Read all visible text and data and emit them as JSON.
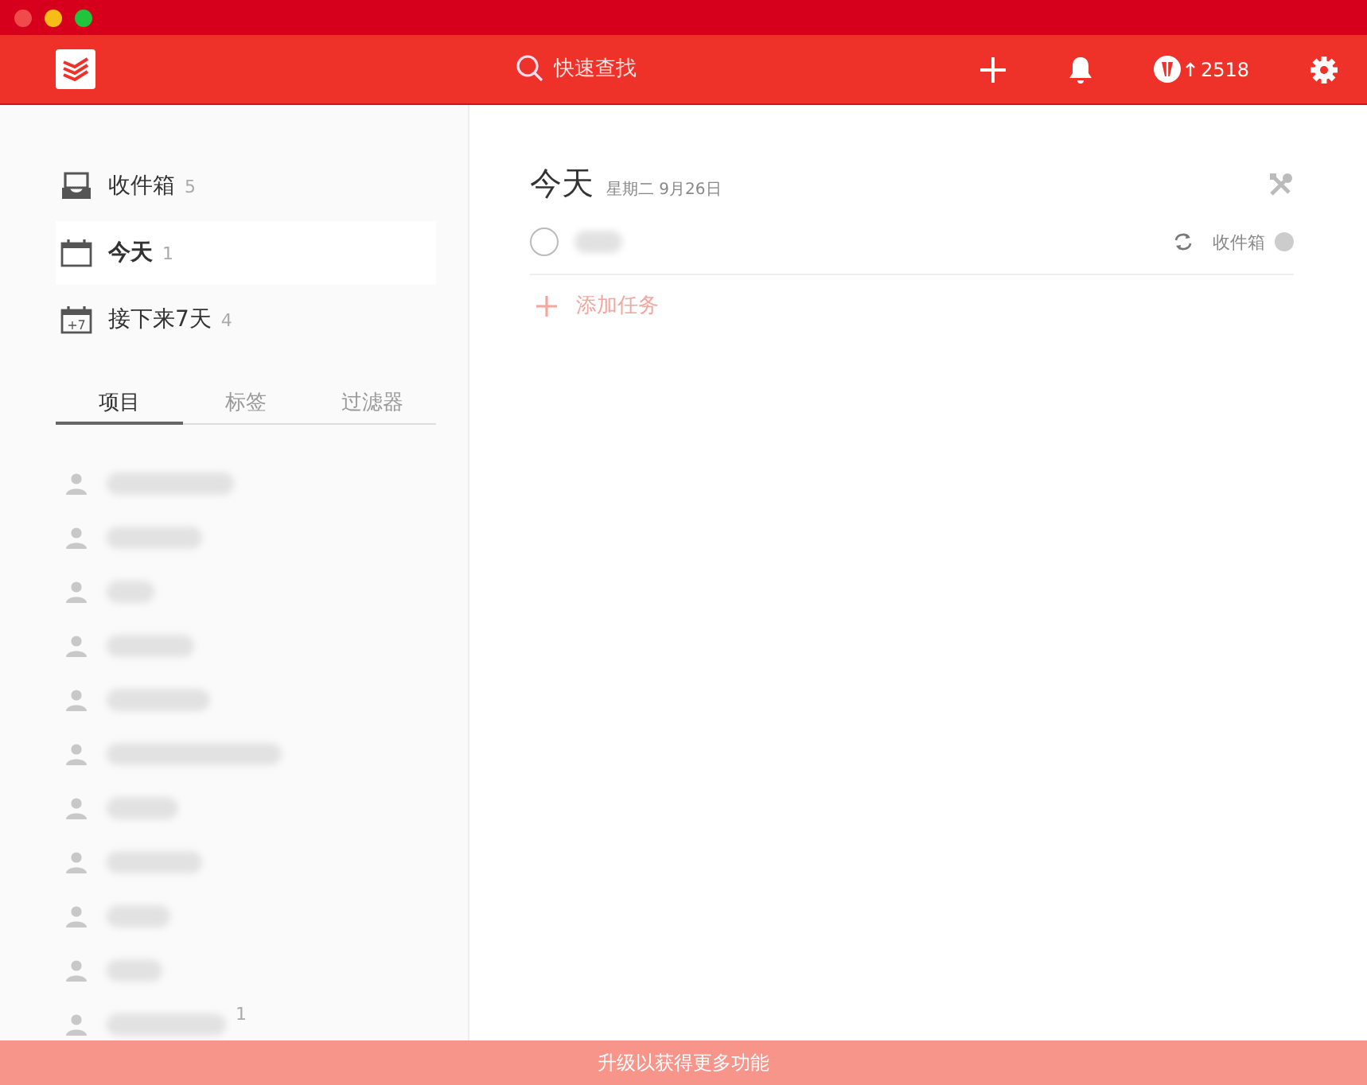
{
  "header": {
    "search_placeholder": "快速查找",
    "karma": "2518"
  },
  "nav": [
    {
      "label": "收件箱",
      "count": "5",
      "kind": "inbox",
      "selected": false
    },
    {
      "label": "今天",
      "count": "1",
      "kind": "today",
      "selected": true
    },
    {
      "label": "接下来7天",
      "count": "4",
      "kind": "week",
      "selected": false,
      "badge": "+7"
    }
  ],
  "tabs": [
    {
      "label": "项目",
      "selected": true
    },
    {
      "label": "标签",
      "selected": false
    },
    {
      "label": "过滤器",
      "selected": false
    }
  ],
  "projects": [
    {
      "shared": true
    },
    {
      "shared": true
    },
    {
      "shared": true
    },
    {
      "shared": true
    },
    {
      "shared": true
    },
    {
      "shared": true
    },
    {
      "shared": true
    },
    {
      "shared": true
    },
    {
      "shared": true
    },
    {
      "shared": true
    },
    {
      "shared": true,
      "count": "1"
    }
  ],
  "main": {
    "title": "今天",
    "date": "星期二 9月26日",
    "tasks": [
      {
        "checked": false,
        "recurring": true,
        "project": "收件箱"
      }
    ],
    "add_task": "添加任务"
  },
  "banner": "升级以获得更多功能"
}
